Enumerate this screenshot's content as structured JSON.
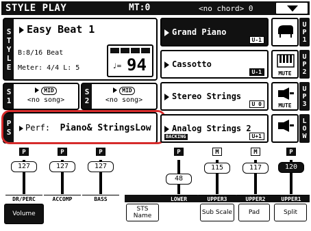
{
  "topbar": {
    "title": "STYLE PLAY",
    "mt": "MT:0",
    "chord": "<no chord> 0"
  },
  "style": {
    "side_label": [
      "S",
      "T",
      "Y",
      "L",
      "E"
    ],
    "name": "Easy Beat 1",
    "beat": "B:8/16 Beat",
    "meter": "Meter: 4/4  L: 5",
    "tempo_note": "♩=",
    "tempo": "94"
  },
  "songs": [
    {
      "side_label": [
        "S",
        "1"
      ],
      "badge": "MID",
      "label": "<no song>"
    },
    {
      "side_label": [
        "S",
        "2"
      ],
      "badge": "MID",
      "label": "<no song>"
    }
  ],
  "perf": {
    "side_label": [
      "P",
      "S"
    ],
    "prefix": "Perf:",
    "name": "Piano& StringsLow"
  },
  "sounds": [
    {
      "name": "Grand Piano",
      "tag": "U-1",
      "tab": [
        "U",
        "P",
        "1"
      ],
      "icon": "piano-icon",
      "mute": ""
    },
    {
      "name": "Cassotto",
      "tag": "U-1",
      "tab": [
        "U",
        "P",
        "2"
      ],
      "icon": "keyboard-icon",
      "mute": "MUTE"
    },
    {
      "name": "Stereo Strings",
      "tag": "U 0",
      "tab": [
        "U",
        "P",
        "3"
      ],
      "icon": "sound-off-icon",
      "mute": "MUTE"
    },
    {
      "name": "Analog Strings 2",
      "tag": "U+1",
      "backing": "BACKING",
      "tab": [
        "L",
        "O",
        "W"
      ],
      "icon": "sound-icon",
      "mute": ""
    }
  ],
  "mixer": [
    {
      "head": "P",
      "value": "127",
      "label": "DR/PERC"
    },
    {
      "head": "P",
      "value": "127",
      "label": "ACCOMP"
    },
    {
      "head": "P",
      "value": "127",
      "label": "BASS"
    },
    {
      "head": "",
      "value": "",
      "label": ""
    },
    {
      "head": "P",
      "value": "48",
      "label": "LOWER"
    },
    {
      "head": "M",
      "value": "115",
      "label": "UPPER3"
    },
    {
      "head": "M",
      "value": "117",
      "label": "UPPER2"
    },
    {
      "head": "P",
      "value": "120",
      "label": "UPPER1"
    }
  ],
  "tabs": [
    {
      "label": "Volume"
    },
    {
      "label": "STS Name"
    },
    {
      "label": "Sub Scale"
    },
    {
      "label": "Pad"
    },
    {
      "label": "Split"
    }
  ],
  "colors": {
    "highlight": "#d62b2b",
    "dark": "#111111"
  }
}
